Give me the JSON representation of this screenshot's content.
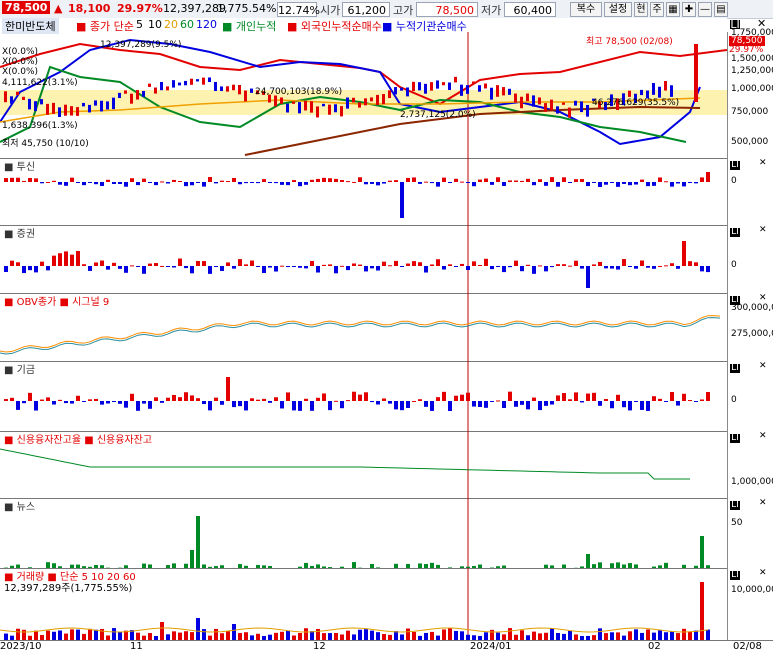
{
  "header": {
    "price": "78,500",
    "change": "18,100",
    "change_pct": "29.97%",
    "volume": "12,397,289",
    "volume_ratio": "1,775.54%",
    "turnover": "12.74%",
    "open_label": "시가",
    "open": "61,200",
    "high_label": "고가",
    "high": "78,500",
    "low_label": "저가",
    "low": "60,400",
    "buttons": [
      "복수",
      "설정",
      "현",
      "주"
    ]
  },
  "legend": {
    "stock": "한미반도체",
    "ma_label": "종가 단순",
    "ma_periods": [
      "5",
      "10",
      "20",
      "60",
      "120"
    ],
    "items": [
      "개인누적",
      "외국인누적순매수",
      "누적기관순매수"
    ]
  },
  "main": {
    "max_label": "최고 78,500 (02/08)",
    "min_label": "최저 45,750 (10/10)",
    "current_price_badge": "78,500",
    "current_pct": "29.97%",
    "annotations": [
      "12,397,289(9.5%)",
      "X(0.0%)",
      "X(0.0%)",
      "X(0.0%)",
      "4,111,622(3.1%)",
      "24,700,103(18.9%)",
      "2,737,125(2.0%)",
      "46,276,629(35.5%)",
      "1,638,396(1.3%)"
    ],
    "axis": [
      "1,750,000",
      "1,500,000",
      "1,250,000",
      "1,000,000",
      "750,000",
      "500,000"
    ]
  },
  "panels": [
    {
      "title": "투신",
      "axis": [
        "0"
      ]
    },
    {
      "title": "증권",
      "axis": [
        "0"
      ]
    },
    {
      "title": "OBV종가",
      "title2": "시그널 9",
      "axis": [
        "300,000,000",
        "275,000,000"
      ]
    },
    {
      "title": "기금",
      "axis": [
        "0"
      ]
    },
    {
      "title": "신용융자잔고율",
      "title2": "신용융자잔고",
      "axis": [
        "1,000,000"
      ]
    },
    {
      "title": "뉴스",
      "axis": [
        "50"
      ]
    },
    {
      "title": "거래량",
      "title2": "단순 5",
      "periods": [
        "10",
        "20",
        "60"
      ],
      "sub": "12,397,289주(1,775.55%)",
      "axis": [
        "10,000,000"
      ]
    }
  ],
  "xaxis": [
    "2023/10",
    "11",
    "12",
    "2024/01",
    "02",
    "02/08"
  ],
  "colors": {
    "up": "#e30000",
    "down": "#0000e0",
    "green": "#008a26",
    "brown": "#8b2500",
    "yellow": "#ffd800"
  }
}
